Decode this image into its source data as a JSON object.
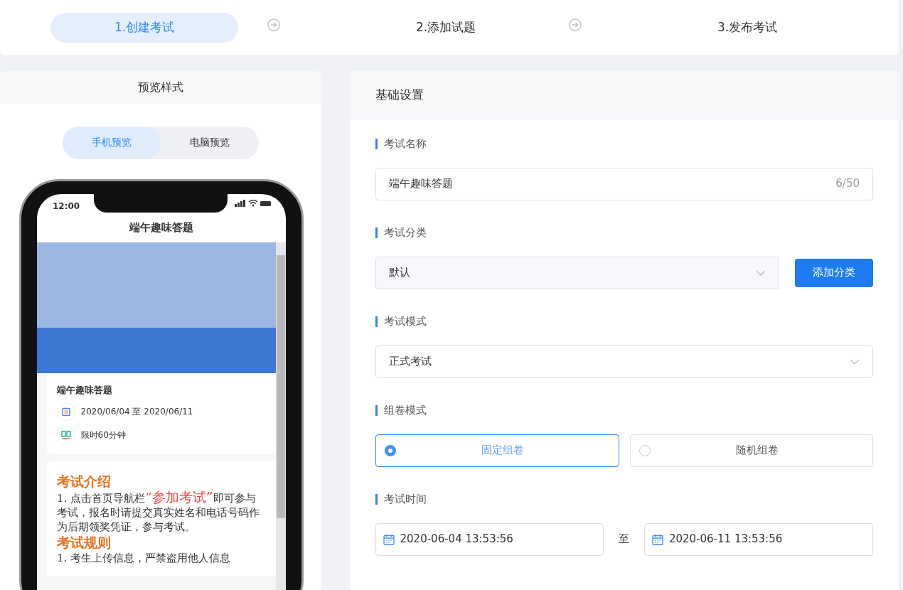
{
  "steps": [
    {
      "label": "1.创建考试",
      "selected": true
    },
    {
      "label": "2.添加试题",
      "selected": false
    },
    {
      "label": "3.发布考试",
      "selected": false
    }
  ],
  "preview": {
    "title": "预览样式",
    "modes": [
      {
        "label": "手机预览",
        "selected": true
      },
      {
        "label": "电脑预览",
        "selected": false
      }
    ],
    "phone": {
      "time": "12:00",
      "title": "端午趣味答题",
      "card": {
        "title": "端午趣味答题",
        "date_range": "2020/06/04 至 2020/06/11",
        "duration": "限时60分钟"
      },
      "content": [
        {
          "kind": "heading",
          "segments": [
            {
              "text": "考试介绍",
              "highlight": false
            }
          ]
        },
        {
          "kind": "paragraph",
          "segments": [
            {
              "text": "1. 点击首页导航栏",
              "highlight": false
            },
            {
              "text": "“参加考试”",
              "highlight": true
            },
            {
              "text": "即可参与考试，报名时请提交真实姓名和电话号码作为后期领奖凭证，参与考试。",
              "highlight": false
            }
          ]
        },
        {
          "kind": "heading",
          "segments": [
            {
              "text": "考试规则",
              "highlight": false
            }
          ]
        },
        {
          "kind": "paragraph",
          "segments": [
            {
              "text": "1. 考生上传信息，严禁盗用他人信息",
              "highlight": false
            }
          ]
        }
      ]
    }
  },
  "settings": {
    "title": "基础设置",
    "name": {
      "label": "考试名称",
      "value": "端午趣味答题",
      "counter": "6/50"
    },
    "category": {
      "label": "考试分类",
      "value": "默认",
      "button": "添加分类"
    },
    "mode": {
      "label": "考试模式",
      "value": "正式考试"
    },
    "compose": {
      "label": "组卷模式",
      "options": [
        {
          "label": "固定组卷",
          "selected": true
        },
        {
          "label": "随机组卷",
          "selected": false
        }
      ]
    },
    "time": {
      "label": "考试时间",
      "start": "2020-06-04 13:53:56",
      "separator": "至",
      "end": "2020-06-11 13:53:56"
    }
  }
}
